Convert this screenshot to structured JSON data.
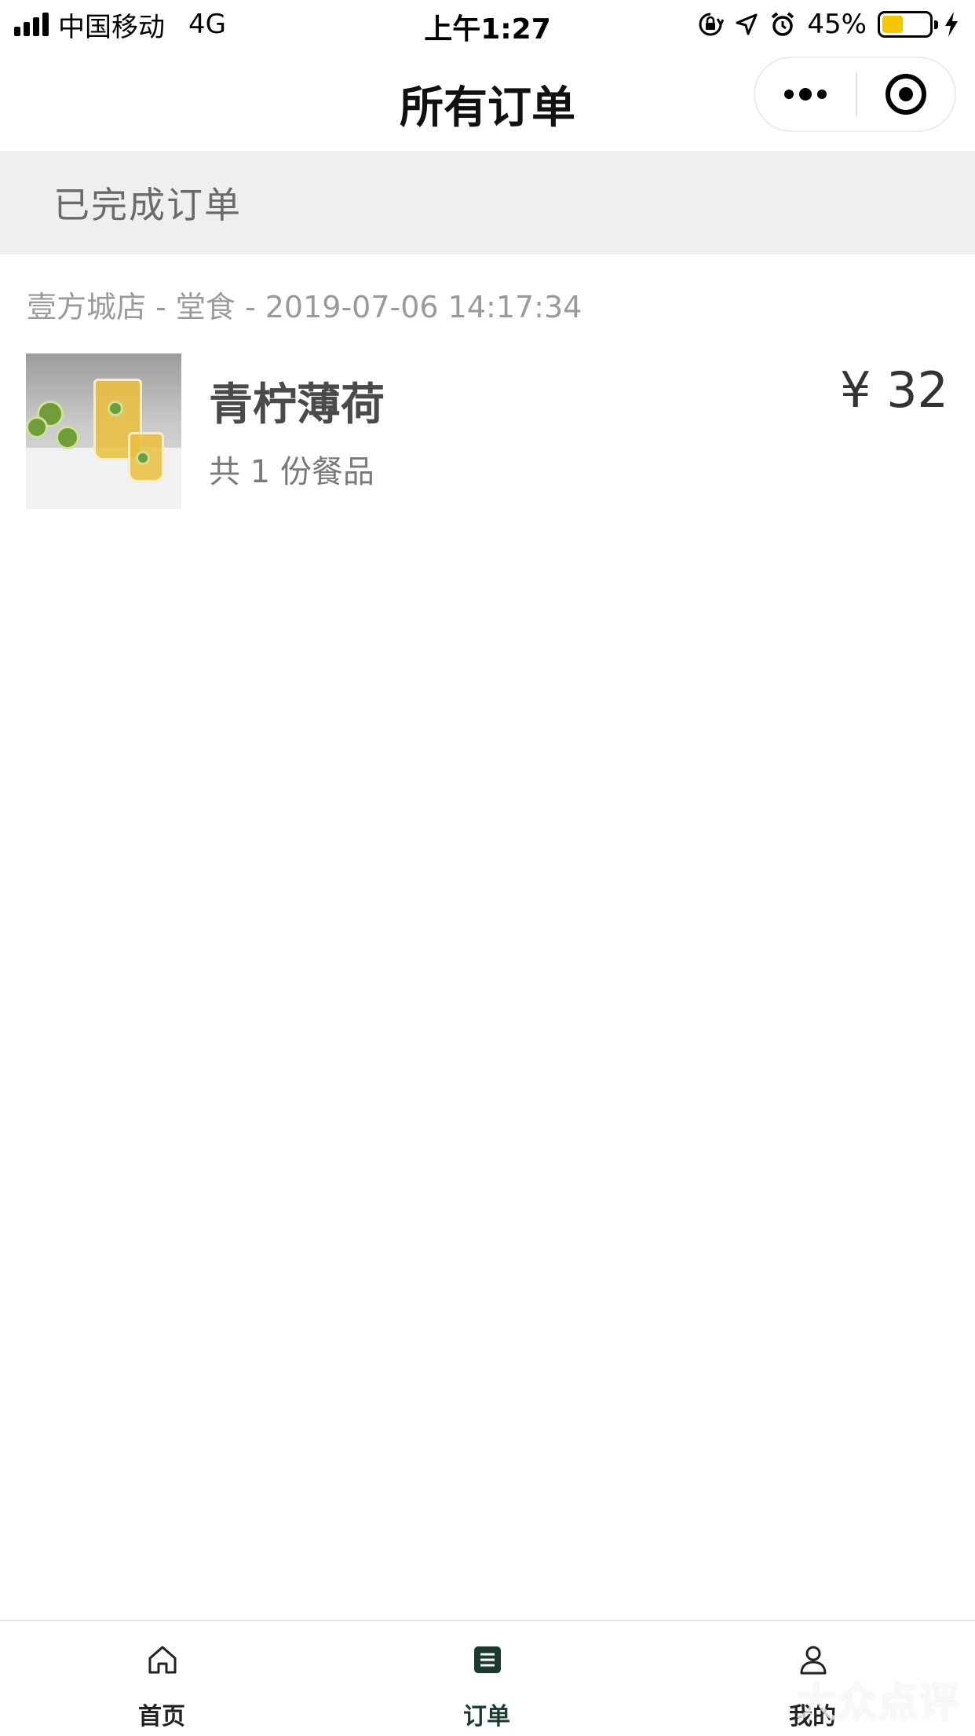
{
  "status_bar": {
    "carrier": "中国移动",
    "network": "4G",
    "time": "上午1:27",
    "battery_percent": "45%",
    "battery_level": 0.45,
    "battery_color": "#f6c600",
    "icons": [
      "signal-icon",
      "rotation-lock-icon",
      "location-icon",
      "alarm-icon",
      "battery-icon",
      "charging-icon"
    ]
  },
  "nav": {
    "title": "所有订单",
    "capsule": {
      "more_icon": "more-dots-icon",
      "close_icon": "target-circle-icon"
    }
  },
  "section": {
    "title": "已完成订单"
  },
  "orders": [
    {
      "meta": "壹方城店 - 堂食 - 2019-07-06 14:17:34",
      "name": "青柠薄荷",
      "count": "共 1 份餐品",
      "price": "¥ 32",
      "image_icon": "lime-mint-drink-image"
    }
  ],
  "tab_bar": {
    "active_color": "#1b3b2f",
    "tabs": [
      {
        "label": "首页",
        "icon": "home-icon",
        "active": false
      },
      {
        "label": "订单",
        "icon": "order-list-icon",
        "active": true
      },
      {
        "label": "我的",
        "icon": "profile-icon",
        "active": false
      }
    ]
  },
  "watermark": "大众点评"
}
